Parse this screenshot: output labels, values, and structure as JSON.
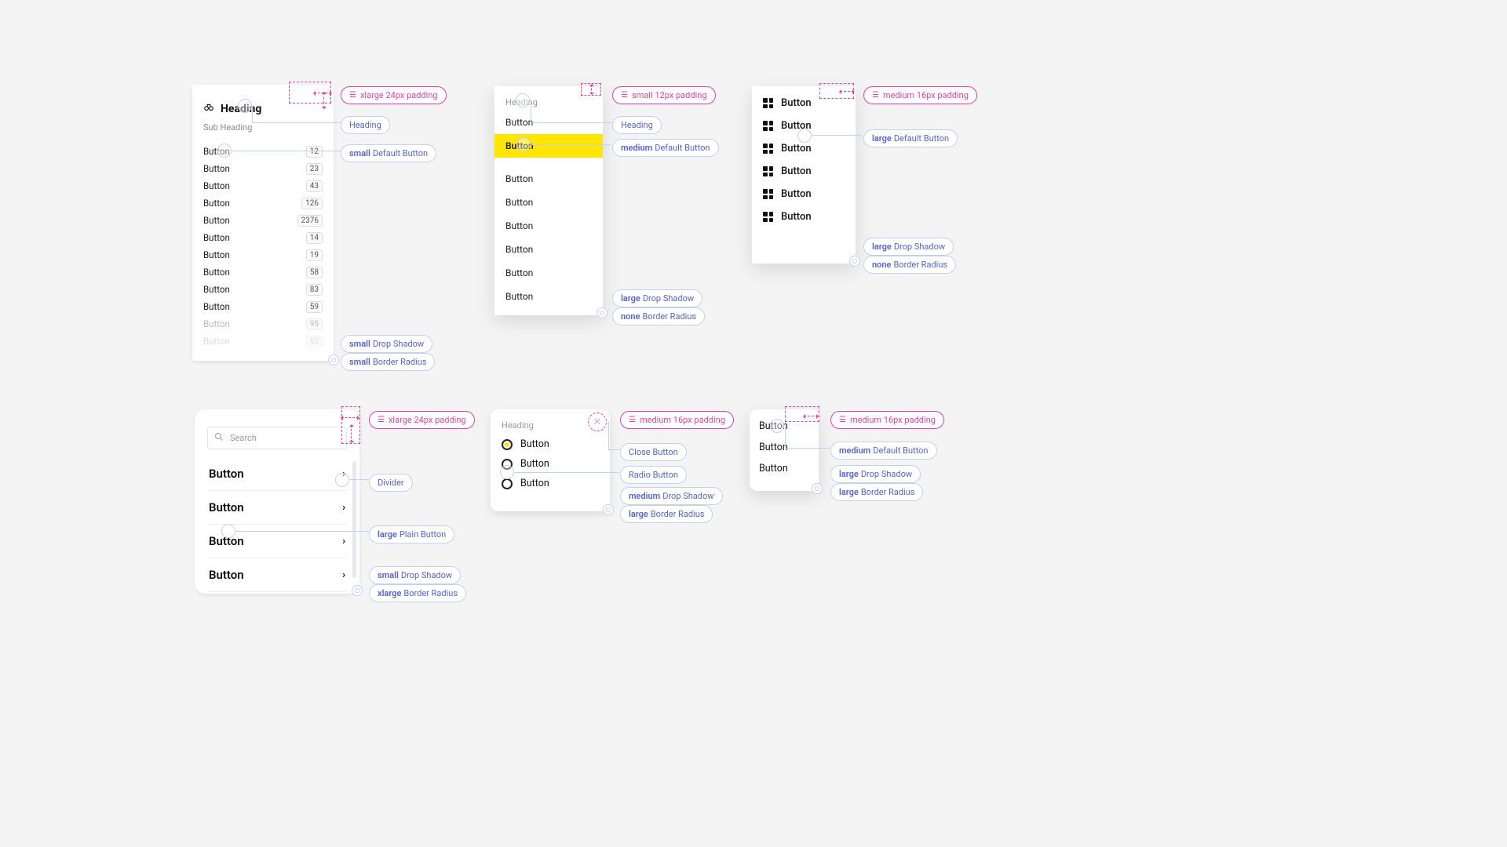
{
  "card1": {
    "padding_label": "xlarge 24px padding",
    "heading": "Heading",
    "sub_heading": "Sub Heading",
    "rows": [
      {
        "label": "Button",
        "count": "12"
      },
      {
        "label": "Button",
        "count": "23"
      },
      {
        "label": "Button",
        "count": "43"
      },
      {
        "label": "Button",
        "count": "126"
      },
      {
        "label": "Button",
        "count": "2376"
      },
      {
        "label": "Button",
        "count": "14"
      },
      {
        "label": "Button",
        "count": "19"
      },
      {
        "label": "Button",
        "count": "58"
      },
      {
        "label": "Button",
        "count": "83"
      },
      {
        "label": "Button",
        "count": "59"
      },
      {
        "label": "Button",
        "count": "95"
      },
      {
        "label": "Button",
        "count": "82"
      }
    ],
    "ann_heading": "Heading",
    "ann_default_btn_b": "small",
    "ann_default_btn": "Default Button",
    "ann_shadow_b": "small",
    "ann_shadow": "Drop Shadow",
    "ann_radius_b": "small",
    "ann_radius": "Border Radius"
  },
  "card2": {
    "padding_label": "small 12px padding",
    "heading": "Heading",
    "items": [
      "Button",
      "Button",
      "Button",
      "Button",
      "Button",
      "Button",
      "Button",
      "Button"
    ],
    "ann_heading": "Heading",
    "ann_default_btn_b": "medium",
    "ann_default_btn": "Default Button",
    "ann_shadow_b": "large",
    "ann_shadow": "Drop Shadow",
    "ann_radius_b": "none",
    "ann_radius": "Border Radius"
  },
  "card3": {
    "padding_label": "medium 16px padding",
    "items": [
      "Button",
      "Button",
      "Button",
      "Button",
      "Button",
      "Button"
    ],
    "ann_default_btn_b": "large",
    "ann_default_btn": "Default Button",
    "ann_shadow_b": "large",
    "ann_shadow": "Drop Shadow",
    "ann_radius_b": "none",
    "ann_radius": "Border Radius"
  },
  "card4": {
    "padding_label": "xlarge 24px padding",
    "search_placeholder": "Search",
    "items": [
      "Button",
      "Button",
      "Button",
      "Button"
    ],
    "ann_divider": "Divider",
    "ann_plain_b": "large",
    "ann_plain": "Plain Button",
    "ann_shadow_b": "small",
    "ann_shadow": "Drop Shadow",
    "ann_radius_b": "xlarge",
    "ann_radius": "Border Radius"
  },
  "card5": {
    "padding_label": "medium 16px padding",
    "heading": "Heading",
    "items": [
      "Button",
      "Button",
      "Button"
    ],
    "ann_close": "Close Button",
    "ann_radio": "Radio Button",
    "ann_shadow_b": "medium",
    "ann_shadow": "Drop Shadow",
    "ann_radius_b": "large",
    "ann_radius": "Border Radius"
  },
  "card6": {
    "padding_label": "medium 16px padding",
    "items": [
      "Button",
      "Button",
      "Button"
    ],
    "ann_default_btn_b": "medium",
    "ann_default_btn": "Default Button",
    "ann_shadow_b": "large",
    "ann_shadow": "Drop Shadow",
    "ann_radius_b": "large",
    "ann_radius": "Border Radius"
  }
}
